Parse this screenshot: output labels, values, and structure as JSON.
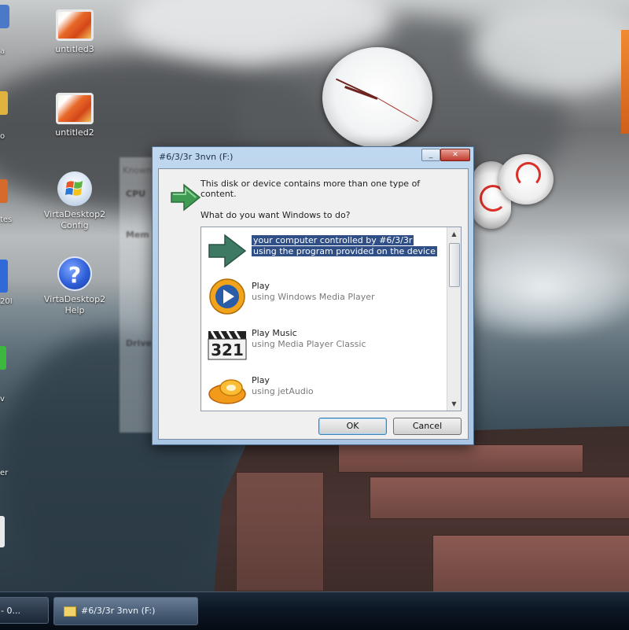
{
  "desktop": {
    "icons": [
      {
        "label": "untitled3",
        "kind": "image"
      },
      {
        "label": "untitled2",
        "kind": "image"
      },
      {
        "label": "VirtaDesktop2 Config",
        "kind": "app"
      },
      {
        "label": "VirtaDesktop2 Help",
        "kind": "help"
      }
    ],
    "left_strip": [
      "a",
      "o",
      "tes",
      "20I",
      "v",
      "er"
    ]
  },
  "background_window": {
    "lines": [
      "Known",
      "CPU",
      "Mem",
      "Drive"
    ]
  },
  "dialog": {
    "title": "#6/3/3r 3nvn (F:)",
    "message": "This disk or device contains more than one type of content.",
    "question": "What do you want Windows to do?",
    "items": [
      {
        "title": "your computer controlled by #6/3/3r",
        "subtitle": "using the program provided on the device",
        "icon": "green-arrow-icon",
        "selected": true
      },
      {
        "title": "Play",
        "subtitle": "using Windows Media Player",
        "icon": "media-player-icon",
        "selected": false
      },
      {
        "title": "Play Music",
        "subtitle": "using Media Player Classic",
        "icon": "media-player-classic-icon",
        "selected": false
      },
      {
        "title": "Play",
        "subtitle": "using jetAudio",
        "icon": "jetaudio-icon",
        "selected": false
      }
    ],
    "ok_label": "OK",
    "cancel_label": "Cancel"
  },
  "taskbar": {
    "items": [
      {
        "label": "- 0...",
        "active": false
      },
      {
        "label": "#6/3/3r 3nvn (F:)",
        "active": true
      }
    ]
  },
  "colors": {
    "selection": "#2f4f86",
    "dialog_frame": "#a9c5e4",
    "taskbar": "#0c1724"
  }
}
